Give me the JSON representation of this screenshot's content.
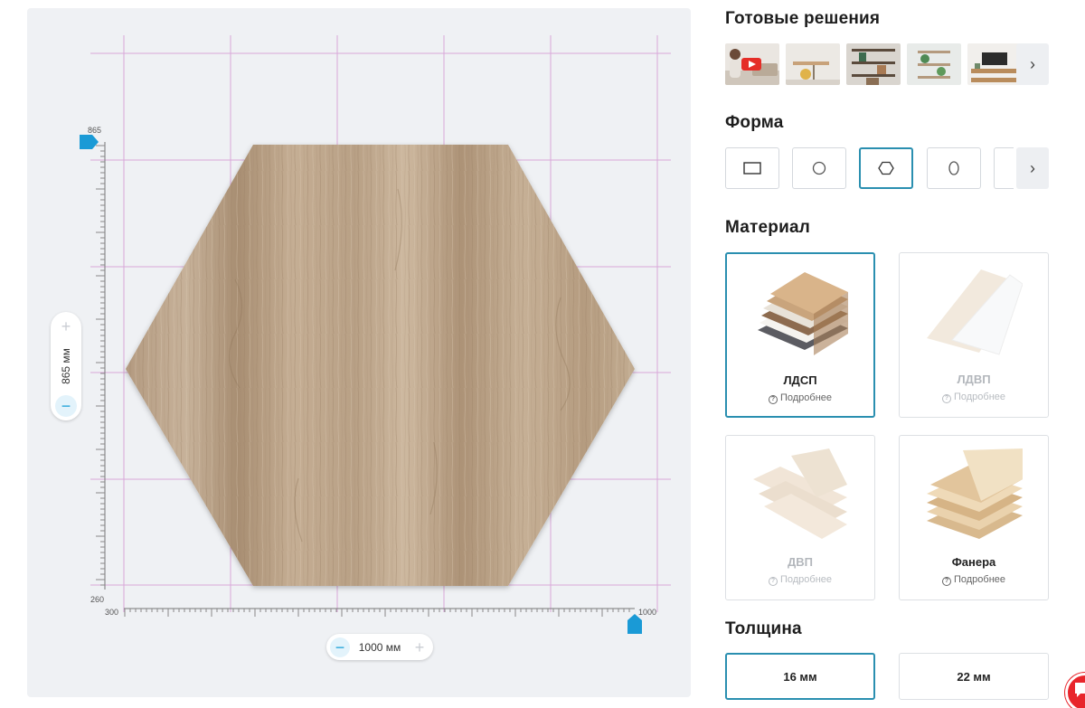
{
  "canvas": {
    "ruler_top_value": "865",
    "ruler_bottom_value": "260",
    "ruler_left_value": "300",
    "ruler_right_value": "1000",
    "height_label": "865  мм",
    "width_label": "1000 мм",
    "accent_color": "#1a9ad6"
  },
  "sidebar": {
    "ready_title": "Готовые решения",
    "shape_title": "Форма",
    "material_title": "Материал",
    "thickness_title": "Толщина",
    "shapes": [
      "rectangle-icon",
      "circle-icon",
      "hexagon-icon",
      "oval-icon"
    ],
    "selected_shape": "hexagon",
    "materials": [
      {
        "name": "ЛДСП",
        "more": "Подробнее",
        "selected": true,
        "enabled": true
      },
      {
        "name": "ЛДВП",
        "more": "Подробнее",
        "selected": false,
        "enabled": false
      },
      {
        "name": "ДВП",
        "more": "Подробнее",
        "selected": false,
        "enabled": false
      },
      {
        "name": "Фанера",
        "more": "Подробнее",
        "selected": false,
        "enabled": true
      }
    ],
    "thickness": [
      {
        "label": "16 мм",
        "selected": true
      },
      {
        "label": "22 мм",
        "selected": false
      }
    ],
    "selected_border_color": "#2a8fb0"
  }
}
